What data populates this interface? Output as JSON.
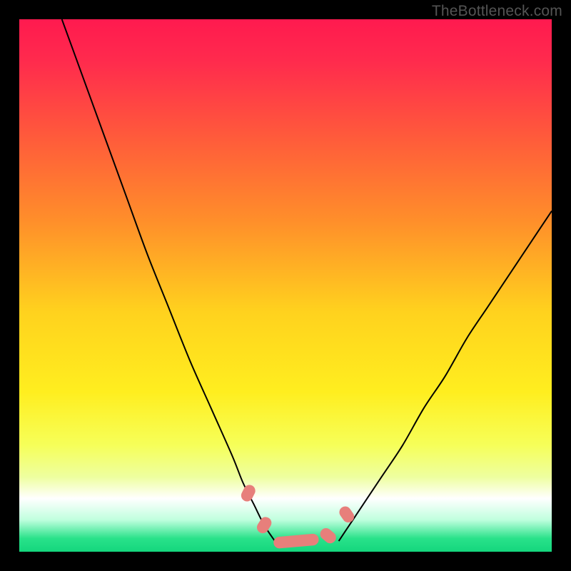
{
  "watermark": "TheBottleneck.com",
  "chart_data": {
    "type": "line",
    "title": "",
    "xlabel": "",
    "ylabel": "",
    "xlim": [
      0,
      100
    ],
    "ylim": [
      0,
      100
    ],
    "series": [
      {
        "name": "left-curve",
        "x": [
          8,
          12,
          16,
          20,
          24,
          28,
          32,
          36,
          40,
          42,
          44,
          46,
          48
        ],
        "y": [
          100,
          89,
          78,
          67,
          56,
          46,
          36,
          27,
          18,
          13,
          9,
          5,
          2
        ]
      },
      {
        "name": "right-curve",
        "x": [
          60,
          62,
          64,
          68,
          72,
          76,
          80,
          84,
          88,
          92,
          96,
          100
        ],
        "y": [
          2,
          5,
          8,
          14,
          20,
          27,
          33,
          40,
          46,
          52,
          58,
          64
        ]
      }
    ],
    "markers": [
      {
        "x": 43,
        "y": 11,
        "angle": -63
      },
      {
        "x": 46,
        "y": 5,
        "angle": -58
      },
      {
        "x": 52,
        "y": 2,
        "angle": -5
      },
      {
        "x": 58,
        "y": 3,
        "angle": 40
      },
      {
        "x": 61.5,
        "y": 7,
        "angle": 55
      }
    ],
    "gradient_stops": [
      {
        "offset": 0,
        "color": "#ff1a4f"
      },
      {
        "offset": 0.08,
        "color": "#ff2b4d"
      },
      {
        "offset": 0.22,
        "color": "#ff5a3b"
      },
      {
        "offset": 0.38,
        "color": "#ff8f2a"
      },
      {
        "offset": 0.55,
        "color": "#ffd21e"
      },
      {
        "offset": 0.7,
        "color": "#ffee1f"
      },
      {
        "offset": 0.8,
        "color": "#f6ff59"
      },
      {
        "offset": 0.86,
        "color": "#eeffa0"
      },
      {
        "offset": 0.9,
        "color": "#ffffff"
      },
      {
        "offset": 0.94,
        "color": "#c0ffde"
      },
      {
        "offset": 0.975,
        "color": "#29e28a"
      },
      {
        "offset": 1.0,
        "color": "#14d67d"
      }
    ],
    "marker_color": "#e77f7b",
    "curve_color": "#000000"
  }
}
